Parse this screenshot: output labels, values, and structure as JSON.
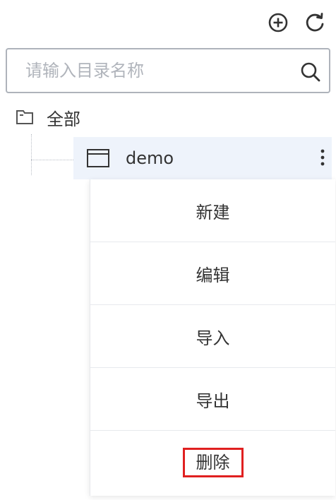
{
  "toolbar": {
    "add_icon": "plus-circle-icon",
    "refresh_icon": "refresh-icon"
  },
  "search": {
    "placeholder": "请输入目录名称",
    "value": "",
    "icon": "search-icon"
  },
  "tree": {
    "root": {
      "label": "全部",
      "icon": "folder-icon"
    },
    "nodes": [
      {
        "label": "demo",
        "icon": "window-icon",
        "more_icon": "more-vertical-icon"
      }
    ]
  },
  "context_menu": {
    "items": [
      {
        "label": "新建"
      },
      {
        "label": "编辑"
      },
      {
        "label": "导入"
      },
      {
        "label": "导出"
      },
      {
        "label": "删除",
        "highlighted": true
      }
    ],
    "highlight_color": "#e02020"
  }
}
